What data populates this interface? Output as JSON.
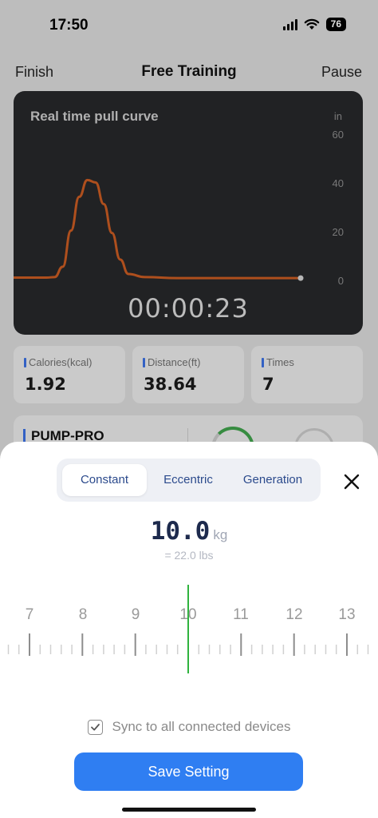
{
  "status_bar": {
    "time": "17:50",
    "battery": "76",
    "icons": [
      "signal-icon",
      "wifi-icon",
      "battery-icon"
    ]
  },
  "nav": {
    "left_label": "Finish",
    "title": "Free Training",
    "right_label": "Pause"
  },
  "chart_card": {
    "title": "Real time pull curve",
    "unit": "in",
    "y_ticks": [
      "60",
      "40",
      "20",
      "0"
    ],
    "timer": "00:00:23"
  },
  "chart_data": {
    "type": "line",
    "title": "Real time pull curve",
    "ylabel": "in",
    "ylim": [
      0,
      60
    ],
    "series": [
      {
        "color": "#c65a22",
        "x": [
          0,
          2,
          4,
          5,
          6,
          7,
          8,
          9,
          10,
          11,
          12,
          13,
          14,
          16,
          20,
          25,
          30,
          35
        ],
        "values": [
          0.5,
          0.5,
          0.5,
          0.7,
          5,
          20,
          34,
          41,
          40,
          31,
          19,
          8,
          2,
          0.7,
          0.3,
          0.3,
          0.3,
          0.3
        ]
      }
    ],
    "xlim": [
      0,
      35
    ],
    "grid": false
  },
  "stats": [
    {
      "label": "Calories(kcal)",
      "value": "1.92"
    },
    {
      "label": "Distance(ft)",
      "value": "38.64"
    },
    {
      "label": "Times",
      "value": "7"
    }
  ],
  "device": {
    "name": "PUMP-PRO"
  },
  "sheet": {
    "modes": [
      "Constant",
      "Eccentric",
      "Generation"
    ],
    "active_mode": "Constant",
    "weight": {
      "value": "10.0",
      "unit": "kg",
      "lbs": "= 22.0 lbs"
    },
    "ruler": {
      "labels": [
        "7",
        "8",
        "9",
        "10",
        "11",
        "12",
        "13"
      ],
      "selected": 10,
      "accent_color": "#2fb33e"
    },
    "sync": {
      "checked": true,
      "label": "Sync to all connected devices"
    },
    "save_label": "Save Setting",
    "accent_color": "#2f7ef2"
  }
}
